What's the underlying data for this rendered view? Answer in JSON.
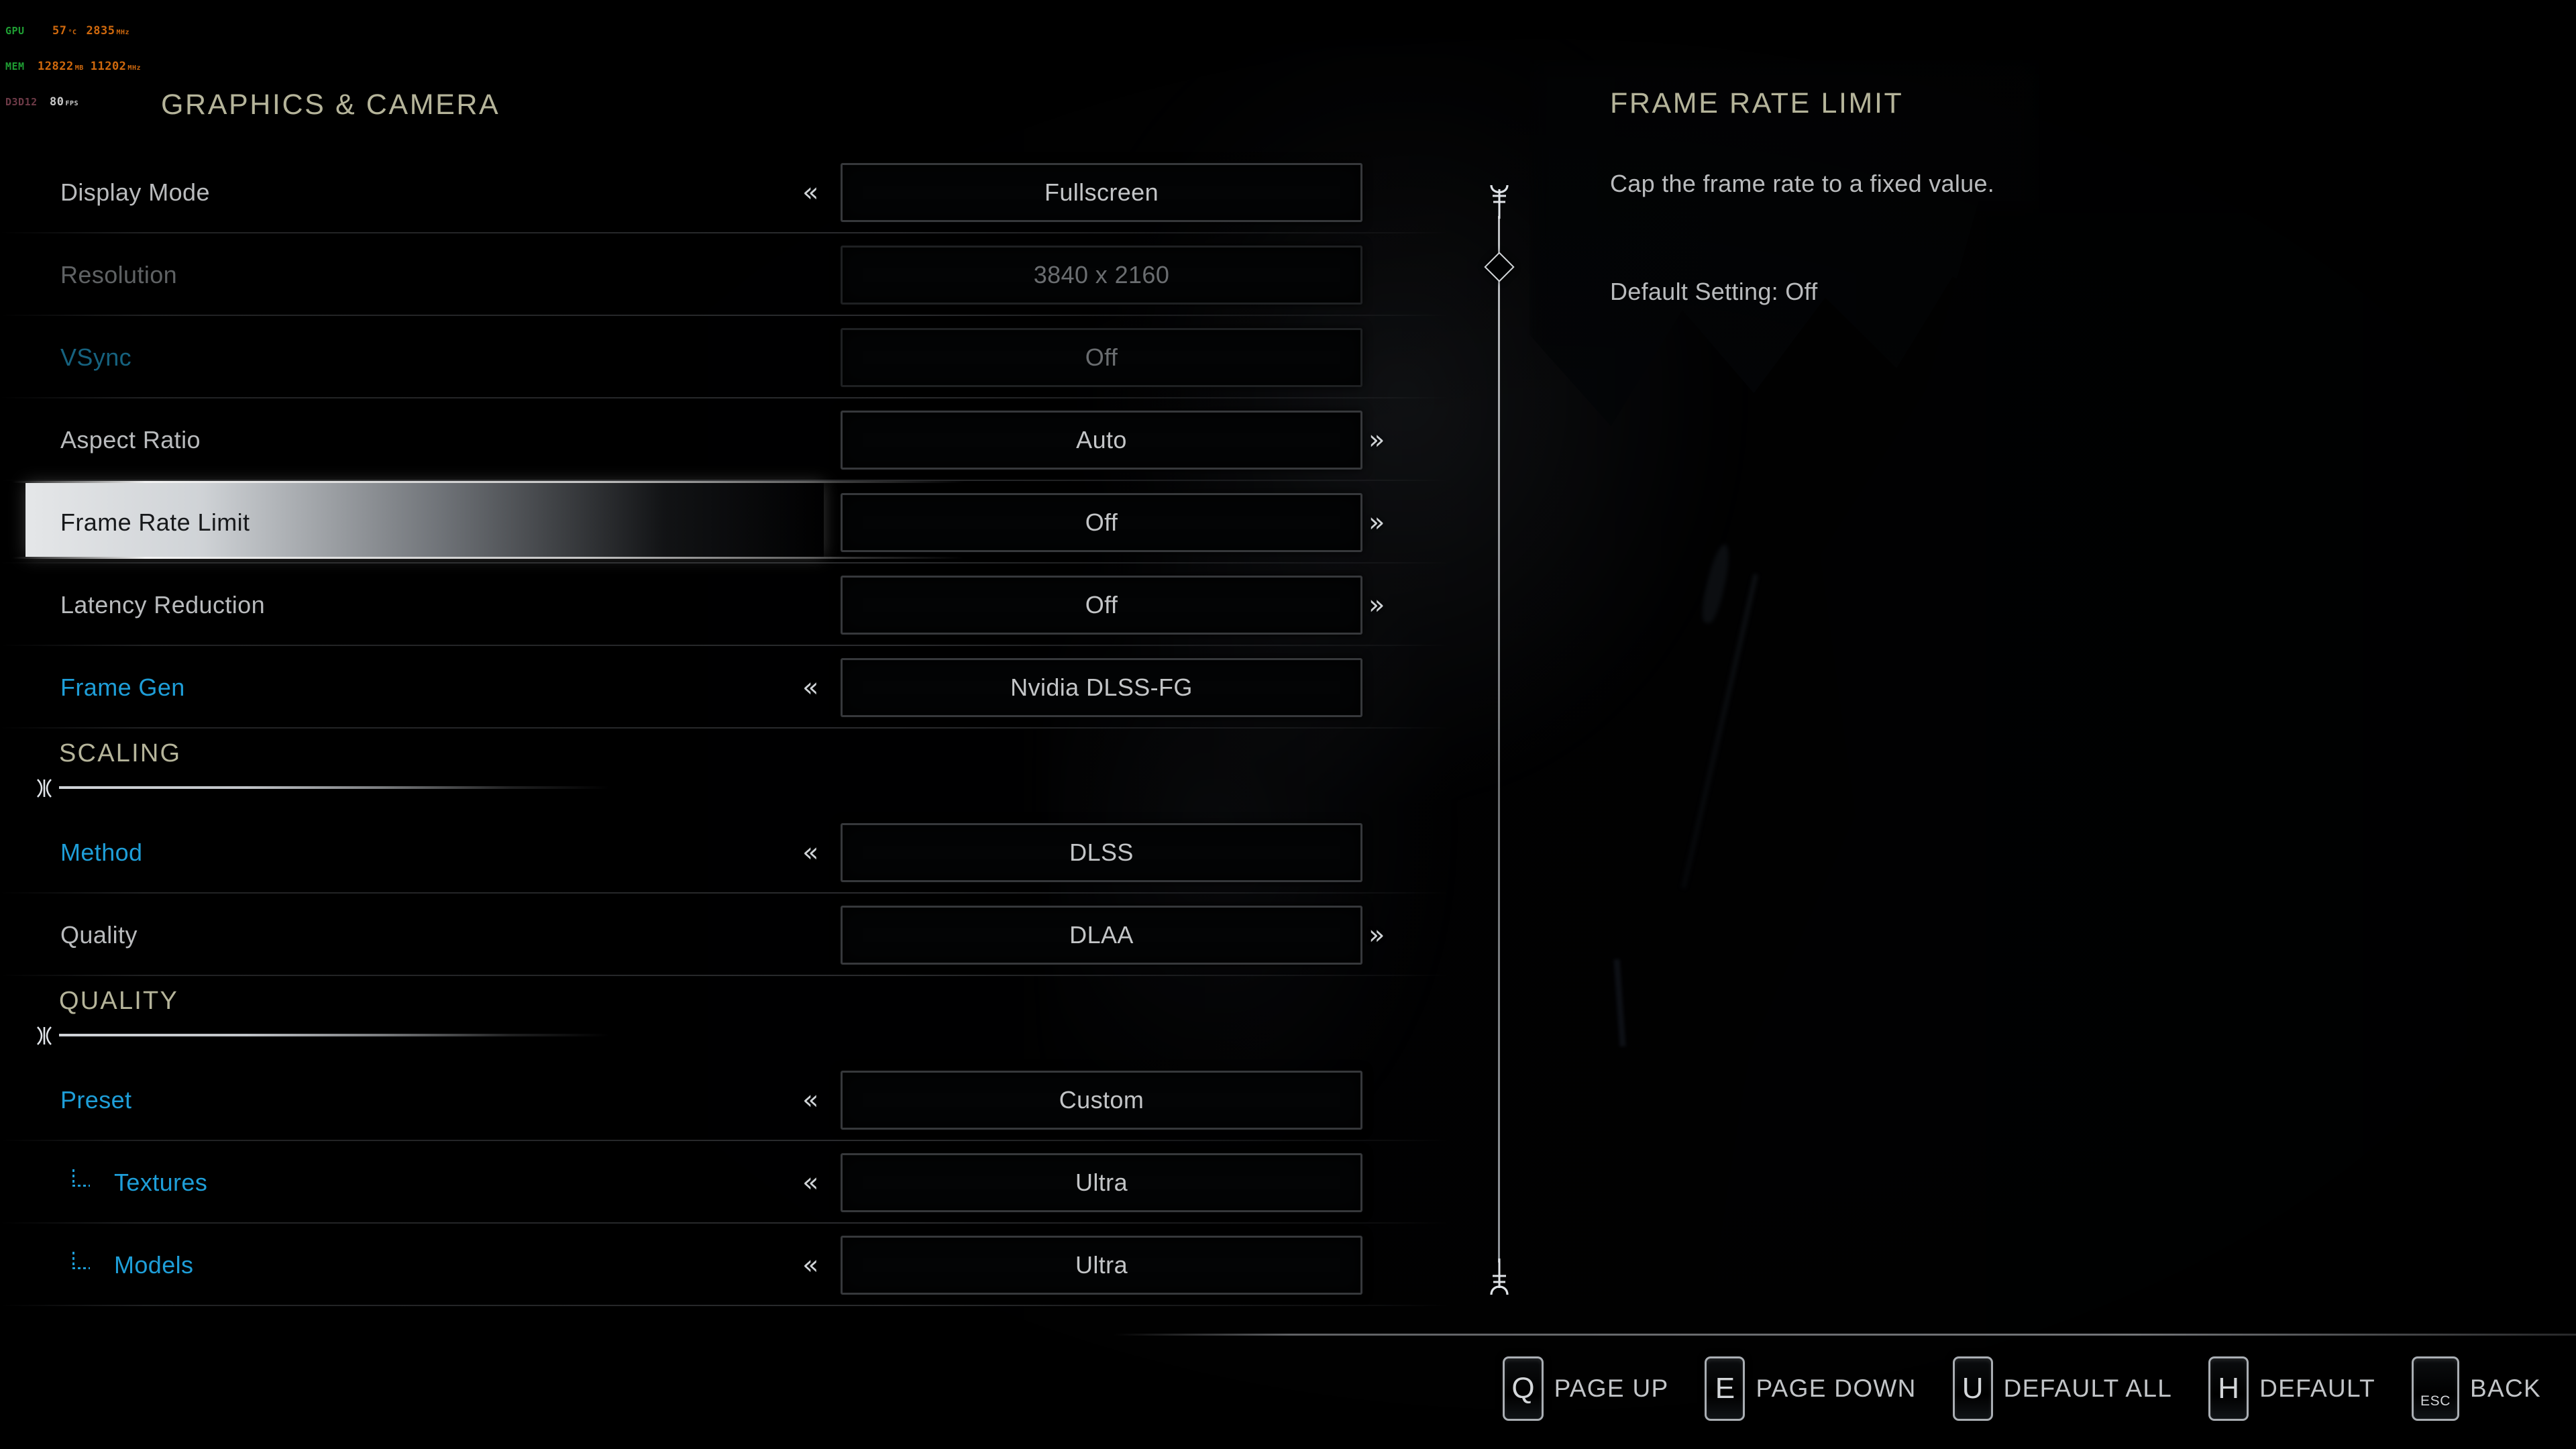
{
  "overlay": {
    "gpu_label": "GPU",
    "gpu_temp": "57",
    "gpu_temp_unit": "°C",
    "gpu_clock": "2835",
    "gpu_clock_unit": "MHz",
    "mem_label": "MEM",
    "mem_used": "12822",
    "mem_used_unit": "MB",
    "mem_clock": "11202",
    "mem_clock_unit": "MHz",
    "api_label": "D3D12",
    "fps": "80",
    "fps_unit": "FPS"
  },
  "page": {
    "title": "GRAPHICS & CAMERA"
  },
  "settings": [
    {
      "type": "setting",
      "label": "Display Mode",
      "value": "Fullscreen",
      "left_chevron": "«",
      "right_chevron": "",
      "state": "normal",
      "indent": 0,
      "selected": false
    },
    {
      "type": "setting",
      "label": "Resolution",
      "value": "3840 x 2160",
      "left_chevron": "",
      "right_chevron": "",
      "state": "disabled",
      "indent": 0,
      "selected": false
    },
    {
      "type": "setting",
      "label": "VSync",
      "value": "Off",
      "left_chevron": "",
      "right_chevron": "",
      "state": "disabled-modified",
      "indent": 0,
      "selected": false
    },
    {
      "type": "setting",
      "label": "Aspect Ratio",
      "value": "Auto",
      "left_chevron": "",
      "right_chevron": "»",
      "state": "normal",
      "indent": 0,
      "selected": false
    },
    {
      "type": "setting",
      "label": "Frame Rate Limit",
      "value": "Off",
      "left_chevron": "",
      "right_chevron": "»",
      "state": "normal",
      "indent": 0,
      "selected": true
    },
    {
      "type": "setting",
      "label": "Latency Reduction",
      "value": "Off",
      "left_chevron": "",
      "right_chevron": "»",
      "state": "normal",
      "indent": 0,
      "selected": false
    },
    {
      "type": "setting",
      "label": "Frame Gen",
      "value": "Nvidia DLSS-FG",
      "left_chevron": "«",
      "right_chevron": "",
      "state": "modified",
      "indent": 0,
      "selected": false
    },
    {
      "type": "section",
      "label": "SCALING"
    },
    {
      "type": "setting",
      "label": "Method",
      "value": "DLSS",
      "left_chevron": "«",
      "right_chevron": "",
      "state": "modified",
      "indent": 0,
      "selected": false
    },
    {
      "type": "setting",
      "label": "Quality",
      "value": "DLAA",
      "left_chevron": "",
      "right_chevron": "»",
      "state": "normal",
      "indent": 0,
      "selected": false
    },
    {
      "type": "section",
      "label": "QUALITY"
    },
    {
      "type": "setting",
      "label": "Preset",
      "value": "Custom",
      "left_chevron": "«",
      "right_chevron": "",
      "state": "modified",
      "indent": 0,
      "selected": false
    },
    {
      "type": "setting",
      "label": "Textures",
      "value": "Ultra",
      "left_chevron": "«",
      "right_chevron": "",
      "state": "modified",
      "indent": 1,
      "selected": false
    },
    {
      "type": "setting",
      "label": "Models",
      "value": "Ultra",
      "left_chevron": "«",
      "right_chevron": "",
      "state": "modified",
      "indent": 1,
      "selected": false
    }
  ],
  "detail": {
    "title": "FRAME RATE LIMIT",
    "description": "Cap the frame rate to a fixed value.",
    "default_setting": "Default Setting: Off"
  },
  "bottom_hints": [
    {
      "key": "Q",
      "label": "PAGE UP"
    },
    {
      "key": "E",
      "label": "PAGE DOWN"
    },
    {
      "key": "U",
      "label": "DEFAULT ALL"
    },
    {
      "key": "H",
      "label": "DEFAULT"
    },
    {
      "key": "ESC",
      "label": "BACK"
    }
  ],
  "colors": {
    "heading": "#b5b49a",
    "label": "#b9bbbd",
    "modified": "#1e9ed8",
    "disabled": "#5f6264",
    "value": "#c3c5c7",
    "highlight": "#f6f8fa",
    "perf_green": "#1f9e33",
    "perf_orange": "#d0690d",
    "perf_api": "#6e3a47"
  }
}
